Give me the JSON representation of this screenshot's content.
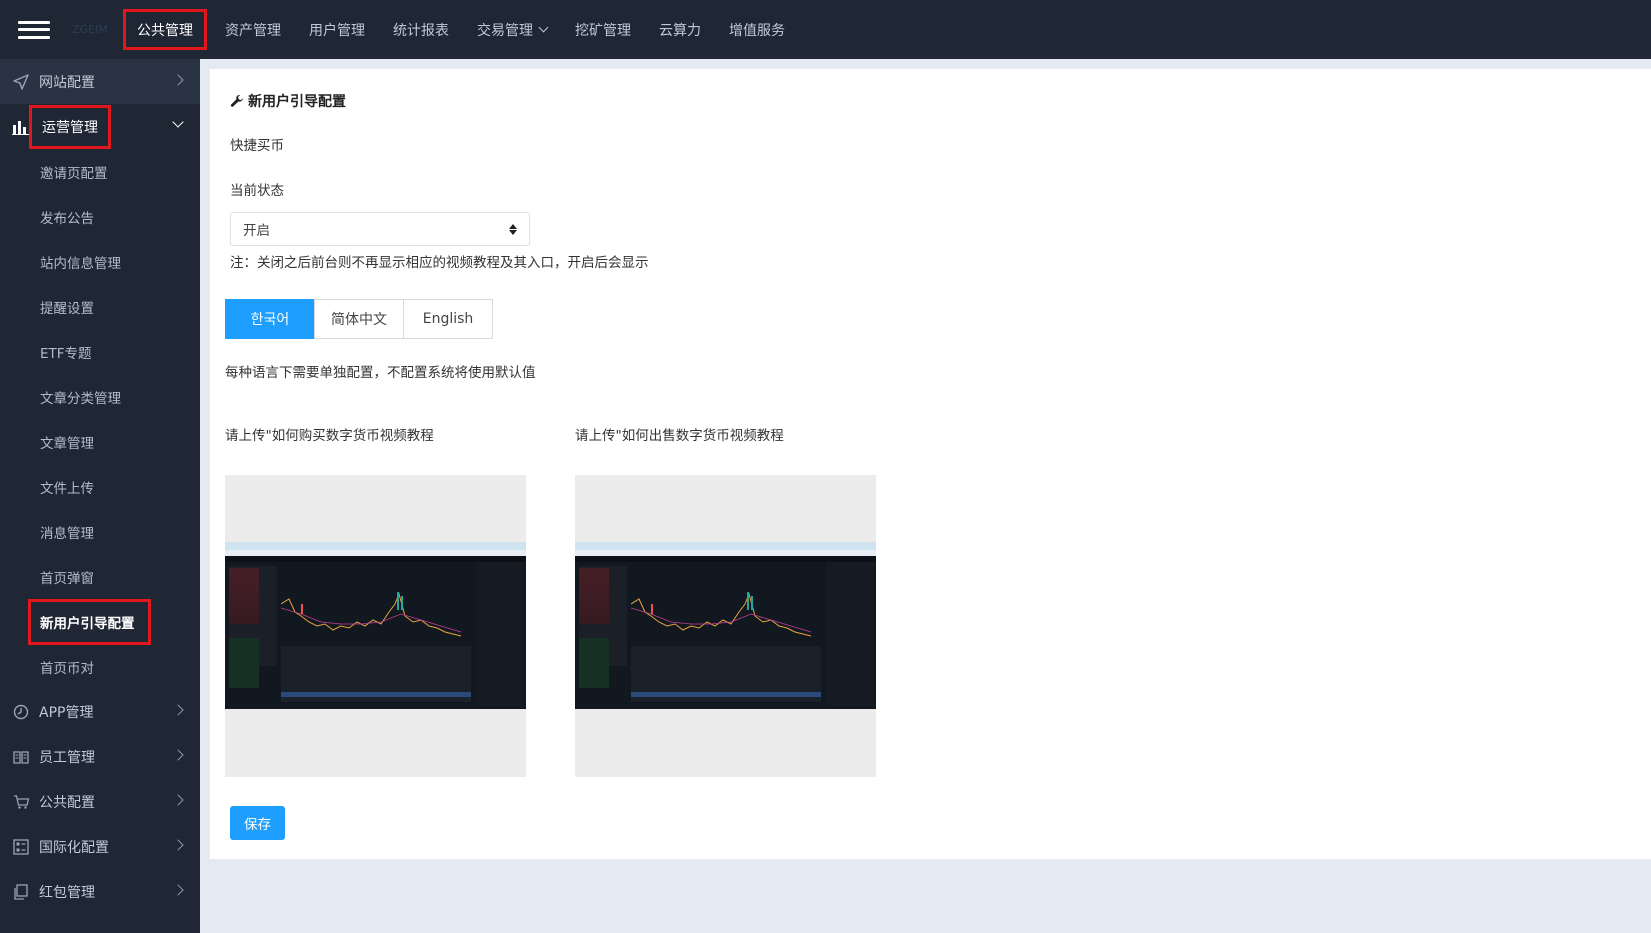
{
  "topbar": {
    "brand": "ZGEIM",
    "nav": [
      {
        "label": "公共管理",
        "active": true
      },
      {
        "label": "资产管理"
      },
      {
        "label": "用户管理"
      },
      {
        "label": "统计报表"
      },
      {
        "label": "交易管理"
      },
      {
        "label": "挖矿管理"
      },
      {
        "label": "云算力"
      },
      {
        "label": "增值服务"
      }
    ]
  },
  "sidebar": {
    "groups_top": [
      {
        "label": "网站配置",
        "icon": "send-icon"
      },
      {
        "label": "运营管理",
        "icon": "bar-chart-icon"
      }
    ],
    "sub_items": [
      {
        "label": "邀请页配置"
      },
      {
        "label": "发布公告"
      },
      {
        "label": "站内信息管理"
      },
      {
        "label": "提醒设置"
      },
      {
        "label": "ETF专题"
      },
      {
        "label": "文章分类管理"
      },
      {
        "label": "文章管理"
      },
      {
        "label": "文件上传"
      },
      {
        "label": "消息管理"
      },
      {
        "label": "首页弹窗"
      },
      {
        "label": "新用户引导配置",
        "active": true
      },
      {
        "label": "首页币对"
      }
    ],
    "groups_bottom": [
      {
        "label": "APP管理",
        "icon": "clock-icon"
      },
      {
        "label": "员工管理",
        "icon": "book-icon"
      },
      {
        "label": "公共配置",
        "icon": "cart-icon"
      },
      {
        "label": "国际化配置",
        "icon": "grid-icon"
      },
      {
        "label": "红包管理",
        "icon": "copy-icon"
      }
    ]
  },
  "page": {
    "title": "新用户引导配置",
    "section_label": "快捷买币",
    "status_label": "当前状态",
    "status_value": "开启",
    "status_note": "注：关闭之后前台则不再显示相应的视频教程及其入口，开启后会显示",
    "lang_tabs": [
      {
        "label": "한국어",
        "active": true
      },
      {
        "label": "简体中文"
      },
      {
        "label": "English"
      }
    ],
    "lang_note": "每种语言下需要单独配置，不配置系统将使用默认值",
    "upload_buy_label": "请上传\"如何购买数字货币视频教程",
    "upload_sell_label": "请上传\"如何出售数字货币视频教程",
    "save_label": "保存"
  },
  "colors": {
    "sidebar_bg": "#1f2634",
    "accent": "#1e9fff",
    "highlight_border": "#e0171d"
  }
}
